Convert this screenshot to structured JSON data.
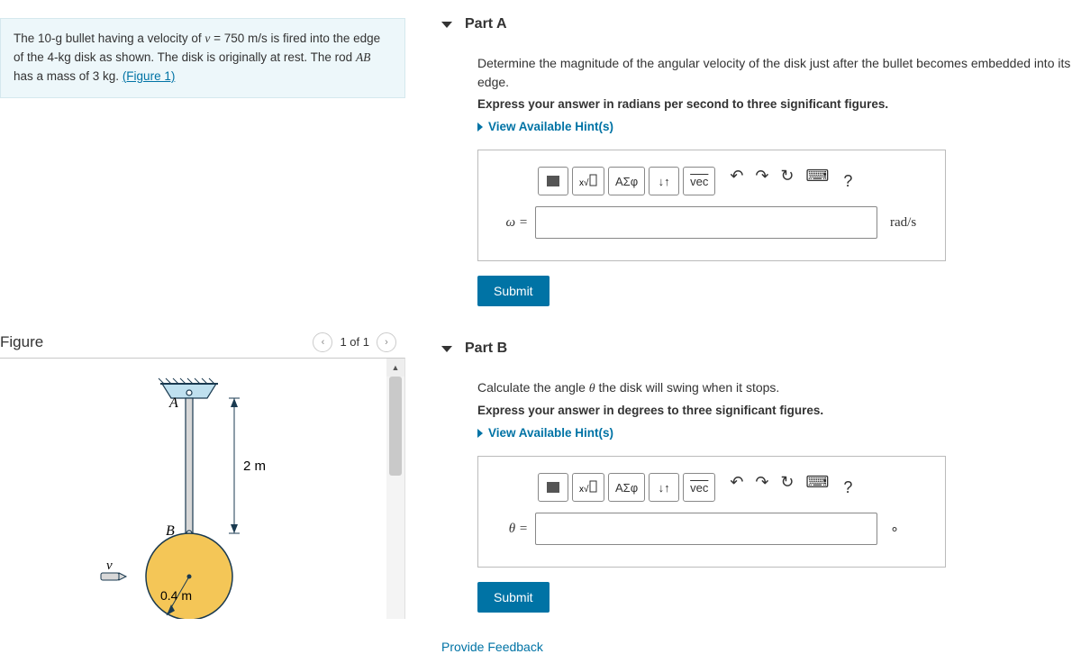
{
  "problem": {
    "text_prefix": "The 10-g bullet having a velocity of ",
    "v_expr": "v = 750 m/s",
    "text_mid1": " is fired into the edge of the 4-kg disk as shown. The disk is originally at rest. The rod ",
    "rod": "AB",
    "text_mid2": " has a mass of 3 kg. ",
    "figure_link": "(Figure 1)"
  },
  "figure": {
    "title": "Figure",
    "pager_text": "1 of 1",
    "labels": {
      "A": "A",
      "B": "B",
      "v": "v",
      "len": "2 m",
      "radius": "0.4 m"
    }
  },
  "partA": {
    "title": "Part A",
    "instr": "Determine the magnitude of the angular velocity of the disk just after the bullet becomes embedded into its edge.",
    "sub_instr": "Express your answer in radians per second to three significant figures.",
    "hint": "View Available Hint(s)",
    "var": "ω =",
    "unit": "rad/s",
    "submit": "Submit",
    "toolbar": {
      "templates": "",
      "greek": "ΑΣφ",
      "arrows": "↓↑",
      "vec": "vec",
      "help": "?"
    }
  },
  "partB": {
    "title": "Part B",
    "instr_prefix": "Calculate the angle ",
    "instr_theta": "θ",
    "instr_suffix": " the disk will swing when it stops.",
    "sub_instr": "Express your answer in degrees to three significant figures.",
    "hint": "View Available Hint(s)",
    "var": "θ =",
    "unit": "∘",
    "submit": "Submit",
    "toolbar": {
      "templates": "",
      "greek": "ΑΣφ",
      "arrows": "↓↑",
      "vec": "vec",
      "help": "?"
    }
  },
  "feedback": "Provide Feedback"
}
